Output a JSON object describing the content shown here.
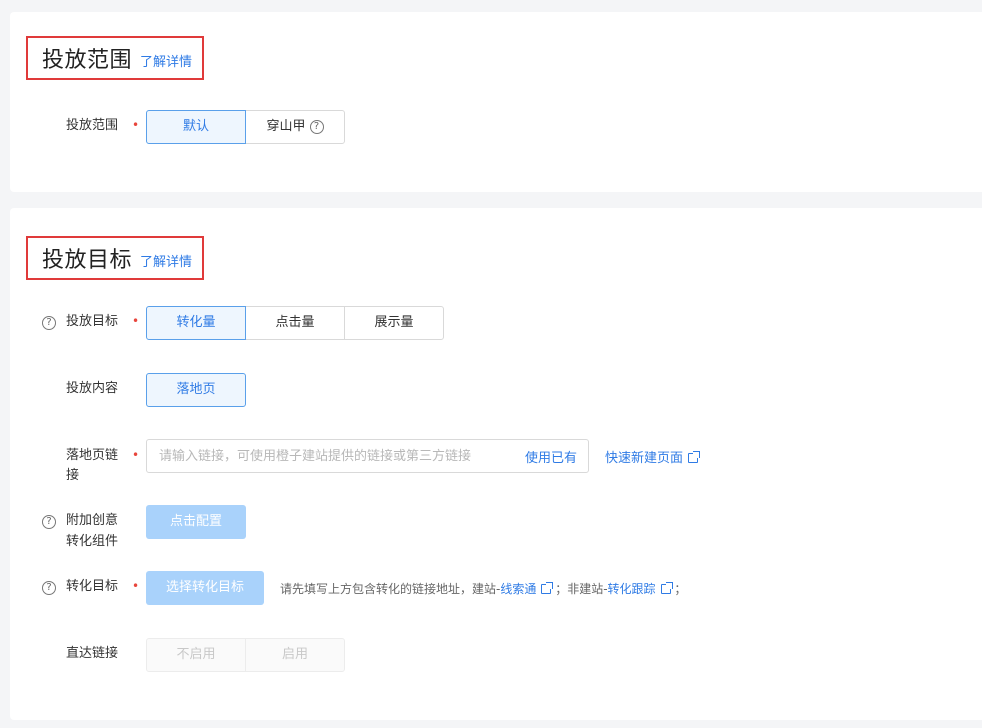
{
  "section_scope": {
    "title": "投放范围",
    "detail_link": "了解详情",
    "field_label": "投放范围",
    "options": [
      "默认",
      "穿山甲"
    ],
    "selected": "默认"
  },
  "section_goal": {
    "title": "投放目标",
    "detail_link": "了解详情",
    "goal": {
      "label": "投放目标",
      "options": [
        "转化量",
        "点击量",
        "展示量"
      ],
      "selected": "转化量"
    },
    "content": {
      "label": "投放内容",
      "option": "落地页"
    },
    "landing_link": {
      "label_line1": "落地页链",
      "label_line2": "接",
      "placeholder": "请输入链接，可使用橙子建站提供的链接或第三方链接",
      "suffix": "使用已有",
      "quick_create": "快速新建页面"
    },
    "extra_component": {
      "label_line1": "附加创意",
      "label_line2": "转化组件",
      "button": "点击配置"
    },
    "conversion_goal": {
      "label": "转化目标",
      "button": "选择转化目标",
      "hint_prefix": "请先填写上方包含转化的链接地址，建站-",
      "hint_link1": "线索通",
      "hint_mid": "；非建站-",
      "hint_link2": "转化跟踪",
      "hint_suffix": "；"
    },
    "direct_link": {
      "label": "直达链接",
      "options": [
        "不启用",
        "启用"
      ]
    }
  },
  "icons": {
    "help": "question-circle-icon",
    "external": "external-link-icon"
  },
  "colors": {
    "accent": "#2f7be5",
    "required": "#e8453c",
    "highlight_border": "#e03a3a",
    "light_button": "#a9d2fb"
  }
}
